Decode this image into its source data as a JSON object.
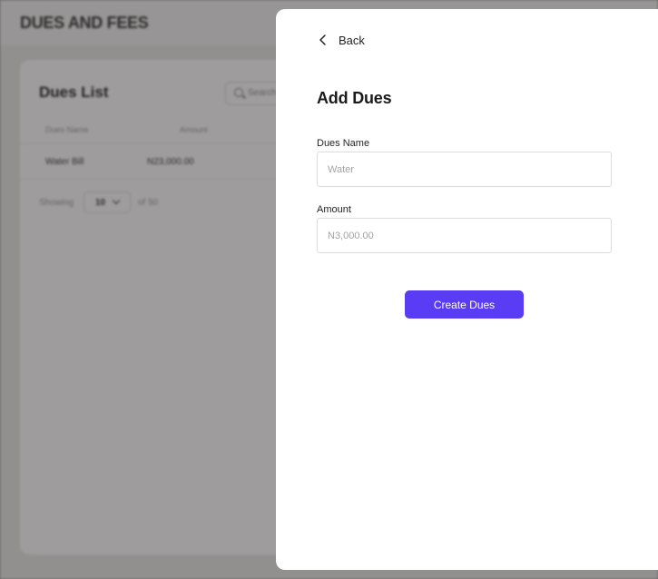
{
  "background_page": {
    "header_title": "DUES AND FEES",
    "card_title": "Dues List",
    "search_placeholder": "Search",
    "table": {
      "columns": [
        "Dues Name",
        "Amount"
      ],
      "rows": [
        {
          "name": "Water Bill",
          "amount": "N23,000.00"
        }
      ]
    },
    "pagination": {
      "showing_label": "Showing",
      "page_size": "10",
      "of_label": "of 50"
    }
  },
  "drawer": {
    "back_label": "Back",
    "title": "Add Dues",
    "fields": {
      "dues_name": {
        "label": "Dues Name",
        "placeholder": "Water",
        "value": ""
      },
      "amount": {
        "label": "Amount",
        "placeholder": "N3,000.00",
        "value": ""
      }
    },
    "submit_label": "Create Dues"
  },
  "colors": {
    "accent": "#5b3cf5",
    "overlay": "#8f8d8c"
  },
  "icons": {
    "back": "chevron-left-icon",
    "search": "search-icon",
    "page_size": "chevron-down-icon"
  }
}
